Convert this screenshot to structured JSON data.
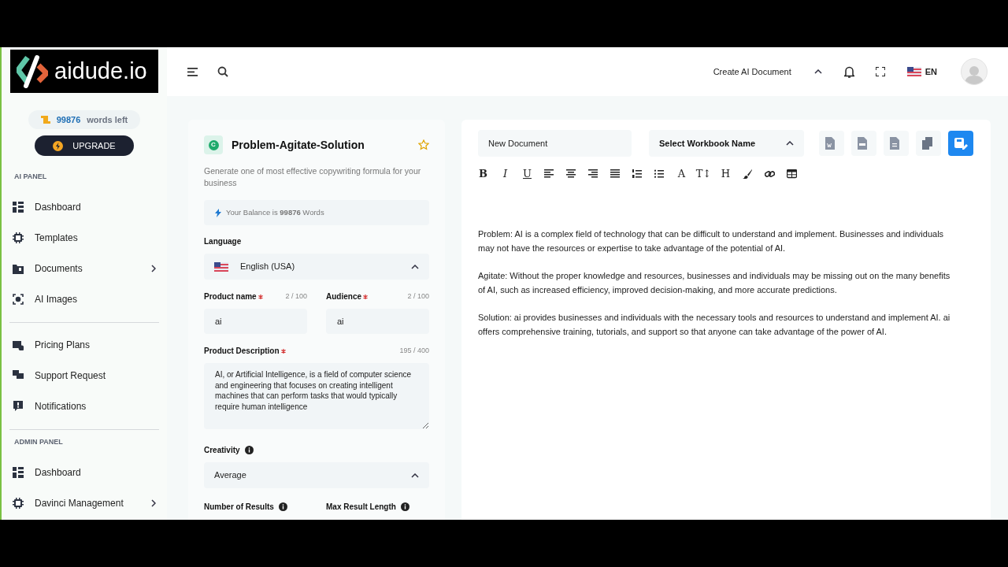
{
  "logo": {
    "text": "aidude.io"
  },
  "sidebar": {
    "words_count": "99876",
    "words_label": "words left",
    "upgrade_button": "UPGRADE",
    "sections": [
      {
        "title": "AI PANEL",
        "items": [
          {
            "label": "Dashboard",
            "has_submenu": false
          },
          {
            "label": "Templates",
            "has_submenu": false
          },
          {
            "label": "Documents",
            "has_submenu": true
          },
          {
            "label": "AI Images",
            "has_submenu": false
          }
        ]
      },
      {
        "items": [
          {
            "label": "Pricing Plans",
            "has_submenu": false
          },
          {
            "label": "Support Request",
            "has_submenu": false
          },
          {
            "label": "Notifications",
            "has_submenu": false
          }
        ]
      },
      {
        "title": "ADMIN PANEL",
        "items": [
          {
            "label": "Dashboard",
            "has_submenu": false
          },
          {
            "label": "Davinci Management",
            "has_submenu": true
          }
        ]
      }
    ]
  },
  "header": {
    "create_menu": "Create AI Document",
    "language": "EN"
  },
  "template": {
    "badge": "C",
    "title": "Problem-Agitate-Solution",
    "favorite": false,
    "description": "Generate one of most effective copywriting formula for your business",
    "balance": "Your Balance is **99876** Words",
    "language_label": "Language",
    "language_value": "English (USA)",
    "fields": [
      {
        "label": "Product name",
        "required": true,
        "counter": "2 / 100",
        "value": "ai"
      },
      {
        "label": "Audience",
        "required": true,
        "counter": "2 / 100",
        "value": "ai"
      }
    ],
    "description_field": {
      "label": "Product Description",
      "required": true,
      "counter": "195 / 400",
      "value": "AI, or Artificial Intelligence, is a field of computer science and engineering that focuses on creating intelligent machines that can perform tasks that would typically require human intelligence"
    },
    "creativity_label": "Creativity",
    "creativity_value": "Average",
    "bottom_labels": [
      "Number of Results",
      "Max Result Length"
    ]
  },
  "editor": {
    "document_name": "New Document",
    "workbook_select": "Select Workbook Name",
    "actions": [
      {
        "kind": "word",
        "primary": false
      },
      {
        "kind": "pdf",
        "primary": false
      },
      {
        "kind": "txt",
        "primary": false
      },
      {
        "kind": "copy",
        "primary": false
      },
      {
        "kind": "save",
        "primary": true
      }
    ],
    "toolbar": [
      {
        "kind": "bold",
        "text": "B"
      },
      {
        "kind": "italic",
        "text": "I"
      },
      {
        "kind": "underline",
        "text": "U"
      },
      {
        "kind": "align-left"
      },
      {
        "kind": "align-center"
      },
      {
        "kind": "align-right"
      },
      {
        "kind": "justify"
      },
      {
        "kind": "ordered-list"
      },
      {
        "kind": "bullet-list"
      },
      {
        "kind": "letter",
        "text": "A"
      },
      {
        "kind": "letter",
        "text": "T↕"
      },
      {
        "kind": "letter",
        "text": "H"
      },
      {
        "kind": "brush"
      },
      {
        "kind": "link"
      },
      {
        "kind": "table"
      }
    ],
    "paragraphs": [
      "Problem: AI is a complex field of technology that can be difficult to understand and implement. Businesses and individuals may not have the resources or expertise to take advantage of the potential of AI.",
      "Agitate: Without the proper knowledge and resources, businesses and individuals may be missing out on the many benefits of AI, such as increased efficiency, improved decision-making, and more accurate predictions.",
      "Solution: ai provides businesses and individuals with the necessary tools and resources to understand and implement AI. ai offers comprehensive training, tutorials, and support so that anyone can take advantage of the power of AI."
    ]
  }
}
